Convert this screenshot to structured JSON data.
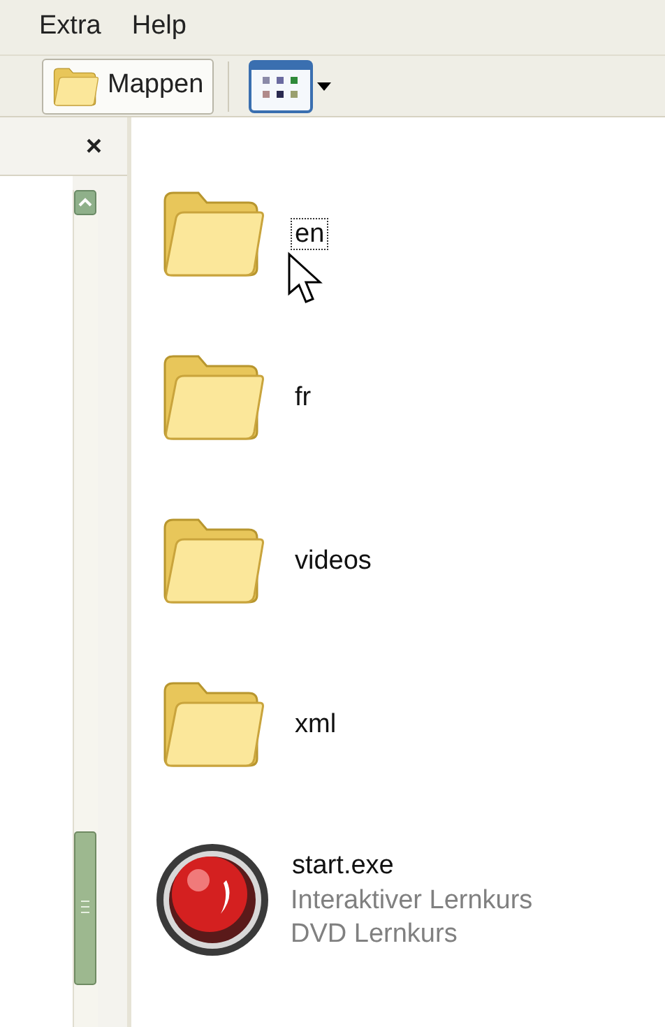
{
  "menu": [
    {
      "label": "Extra"
    },
    {
      "label": "Help"
    }
  ],
  "toolbar": {
    "folders_button": {
      "label": "Mappen",
      "selected": true
    }
  },
  "folders_pane": {
    "close": "×"
  },
  "items": [
    {
      "kind": "folder",
      "name": "en",
      "focused": true
    },
    {
      "kind": "folder",
      "name": "fr",
      "focused": false
    },
    {
      "kind": "folder",
      "name": "videos",
      "focused": false
    },
    {
      "kind": "folder",
      "name": "xml",
      "focused": false
    },
    {
      "kind": "app",
      "name": "start.exe",
      "focused": false,
      "details": [
        "Interaktiver Lernkurs",
        "DVD Lernkurs"
      ]
    }
  ]
}
